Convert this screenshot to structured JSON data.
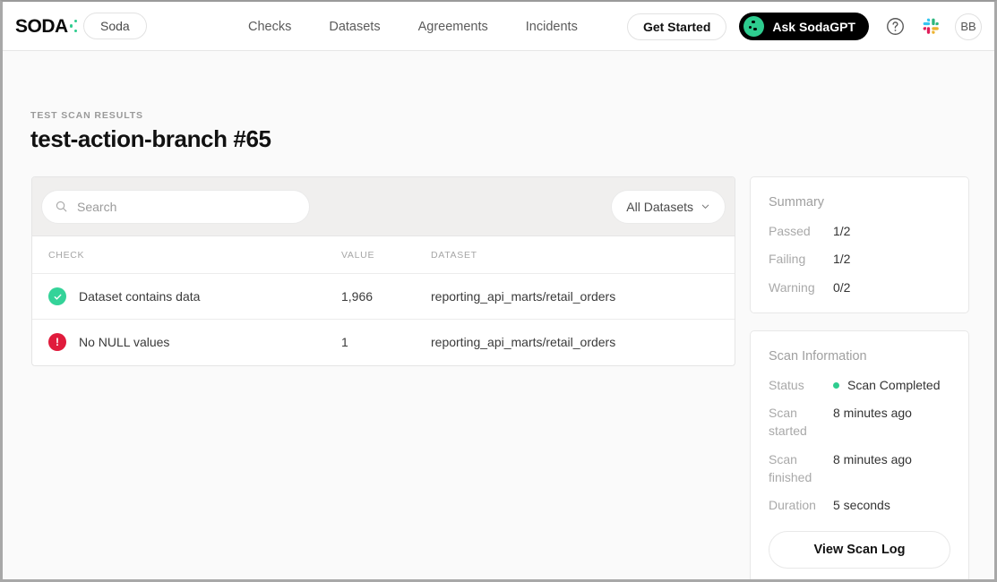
{
  "header": {
    "logo_text": "SODA",
    "logo_icon": "soda-logo",
    "org_label": "Soda",
    "nav": [
      {
        "label": "Checks"
      },
      {
        "label": "Datasets"
      },
      {
        "label": "Agreements"
      },
      {
        "label": "Incidents"
      }
    ],
    "get_started_label": "Get Started",
    "sodagpt_label": "Ask SodaGPT",
    "help_icon": "question-mark-circle-icon",
    "slack_icon": "slack-icon",
    "avatar_initials": "BB"
  },
  "page": {
    "eyebrow": "TEST SCAN RESULTS",
    "title": "test-action-branch #65"
  },
  "filters": {
    "search_placeholder": "Search",
    "search_value": "",
    "search_icon": "search-icon",
    "dataset_filter_label": "All Datasets",
    "chevron_icon": "chevron-down-icon"
  },
  "table": {
    "columns": [
      "CHECK",
      "VALUE",
      "DATASET"
    ],
    "rows": [
      {
        "status": "pass",
        "status_icon": "check-circle-icon",
        "check": "Dataset contains data",
        "value": "1,966",
        "dataset": "reporting_api_marts/retail_orders"
      },
      {
        "status": "fail",
        "status_icon": "error-circle-icon",
        "check": "No NULL values",
        "value": "1",
        "dataset": "reporting_api_marts/retail_orders"
      }
    ]
  },
  "summary": {
    "title": "Summary",
    "rows": [
      {
        "label": "Passed",
        "value": "1/2"
      },
      {
        "label": "Failing",
        "value": "1/2"
      },
      {
        "label": "Warning",
        "value": "0/2"
      }
    ]
  },
  "scan_info": {
    "title": "Scan Information",
    "status_label": "Status",
    "status_value": "Scan Completed",
    "status_dot_color": "#2ecc8f",
    "rows": [
      {
        "label": "Scan started",
        "value": "8 minutes ago"
      },
      {
        "label": "Scan finished",
        "value": "8 minutes ago"
      },
      {
        "label": "Duration",
        "value": "5 seconds"
      }
    ],
    "view_log_label": "View Scan Log"
  },
  "colors": {
    "pass": "#34d399",
    "fail": "#e01b3c",
    "accent_green": "#2ecc8f",
    "black": "#000000"
  }
}
